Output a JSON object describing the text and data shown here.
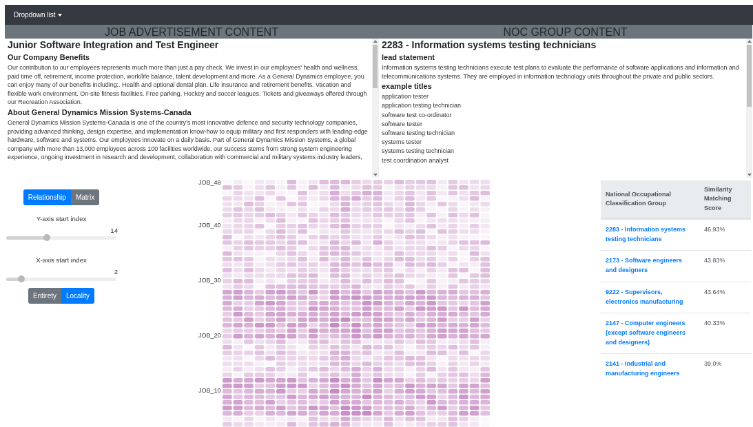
{
  "navbar": {
    "dropdown": "Dropdown list"
  },
  "job_panel": {
    "header": "JOB ADVERTISEMENT CONTENT",
    "title": "Junior Software Integration and Test Engineer",
    "sections": [
      {
        "heading": "Our Company Benefits",
        "text": "Our contribution to our employees represents much more than just a pay check. We invest in our employees’ health and wellness, paid time off, retirement, income protection, work/life balance, talent development and more. As a General Dynamics employee, you can enjoy many of our benefits including:. Health and optional dental plan. Life insurance and retirement benefits. Vacation and flexible work environment. On-site fitness facilities. Free parking. Hockey and soccer leagues. Tickets and giveaways offered through our Recreation Association."
      },
      {
        "heading": "About General Dynamics Mission Systems-Canada",
        "text": "General Dynamics Mission Systems-Canada is one of the country’s most innovative defence and security technology companies, providing advanced thinking, design expertise, and implementation know-how to equip military and first responders with leading-edge hardware, software and systems. Our employees innovate on a daily basis. Part of General Dynamics Mission Systems, a global company with more than 13,000 employees across 100 facilities worldwide, our success stems from strong system engineering experience, ongoing investment in research and development, collaboration with commercial and military systems industry leaders,"
      }
    ]
  },
  "noc_panel": {
    "header": "NOC GROUP CONTENT",
    "title": "2283 - Information systems testing technicians",
    "lead_heading": "lead statement",
    "lead_text": "Information systems testing technicians execute test plans to evaluate the performance of software applications and information and telecommunications systems. They are employed in information technology units throughout the private and public sectors.",
    "titles_heading": "example titles",
    "example_titles": [
      "application tester",
      "application testing technician",
      "software test co-ordinator",
      "software tester",
      "software testing technician",
      "systems tester",
      "systems testing technician",
      "test coordination analyst"
    ]
  },
  "view_toggle": [
    {
      "label": "Relationship",
      "selected": true
    },
    {
      "label": "Matrix",
      "selected": false
    }
  ],
  "sliders": [
    {
      "label": "Y-axis start index",
      "reading": "14",
      "level": 0.37
    },
    {
      "label": "X-axis start index",
      "reading": "2",
      "level": 0.14
    }
  ],
  "scope_toggle": [
    {
      "label": "Entirety",
      "selected": false
    },
    {
      "label": "Locality",
      "selected": true
    }
  ],
  "heatmap": {
    "y_labels": [
      "JOB_48",
      "JOB_40",
      "JOB_30",
      "JOB_20",
      "JOB_10"
    ]
  },
  "table": {
    "columns": [
      "National Occupational Classification Group",
      "Similarity Matching Score"
    ],
    "rows": [
      {
        "group": "2283 - Information systems testing technicians",
        "score": "46.93%"
      },
      {
        "group": "2173 - Software engineers and designers",
        "score": "43.83%"
      },
      {
        "group": "9222 - Supervisors, electronics manufacturing",
        "score": "43.64%"
      },
      {
        "group": "2147 - Computer engineers (except software engineers and designers)",
        "score": "40.33%"
      },
      {
        "group": "2141 - Industrial and manufacturing engineers",
        "score": "39.0%"
      }
    ]
  }
}
